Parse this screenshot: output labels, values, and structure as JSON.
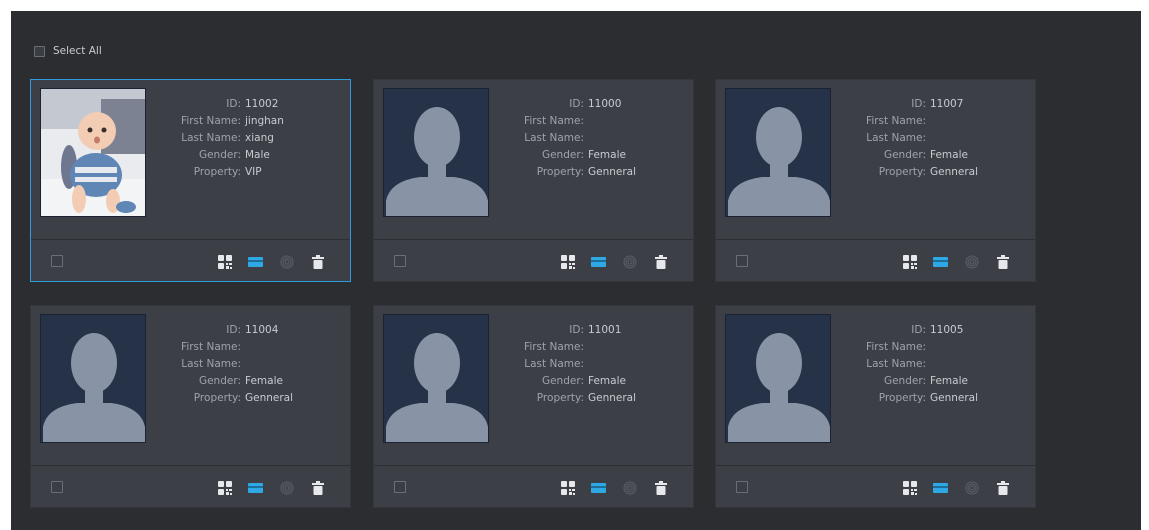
{
  "select_all_label": "Select All",
  "labels": {
    "id": "ID:",
    "first_name": "First Name:",
    "last_name": "Last Name:",
    "gender": "Gender:",
    "property": "Property:"
  },
  "colors": {
    "panel_bg": "#2b2d31",
    "card_bg": "#3c3f45",
    "selected_border": "#2f9cde",
    "accent": "#2fa8e6"
  },
  "actions": [
    "qr-code-icon",
    "card-icon",
    "fingerprint-icon",
    "trash-icon"
  ],
  "persons": [
    {
      "id": "11002",
      "first_name": "jinghan",
      "last_name": "xiang",
      "gender": "Male",
      "property": "VIP",
      "photo": "baby-photo",
      "selected": true
    },
    {
      "id": "11000",
      "first_name": "",
      "last_name": "",
      "gender": "Female",
      "property": "Genneral",
      "photo": "default-avatar",
      "selected": false
    },
    {
      "id": "11007",
      "first_name": "",
      "last_name": "",
      "gender": "Female",
      "property": "Genneral",
      "photo": "default-avatar",
      "selected": false
    },
    {
      "id": "11004",
      "first_name": "",
      "last_name": "",
      "gender": "Female",
      "property": "Genneral",
      "photo": "default-avatar",
      "selected": false
    },
    {
      "id": "11001",
      "first_name": "",
      "last_name": "",
      "gender": "Female",
      "property": "Genneral",
      "photo": "default-avatar",
      "selected": false
    },
    {
      "id": "11005",
      "first_name": "",
      "last_name": "",
      "gender": "Female",
      "property": "Genneral",
      "photo": "default-avatar",
      "selected": false
    }
  ]
}
